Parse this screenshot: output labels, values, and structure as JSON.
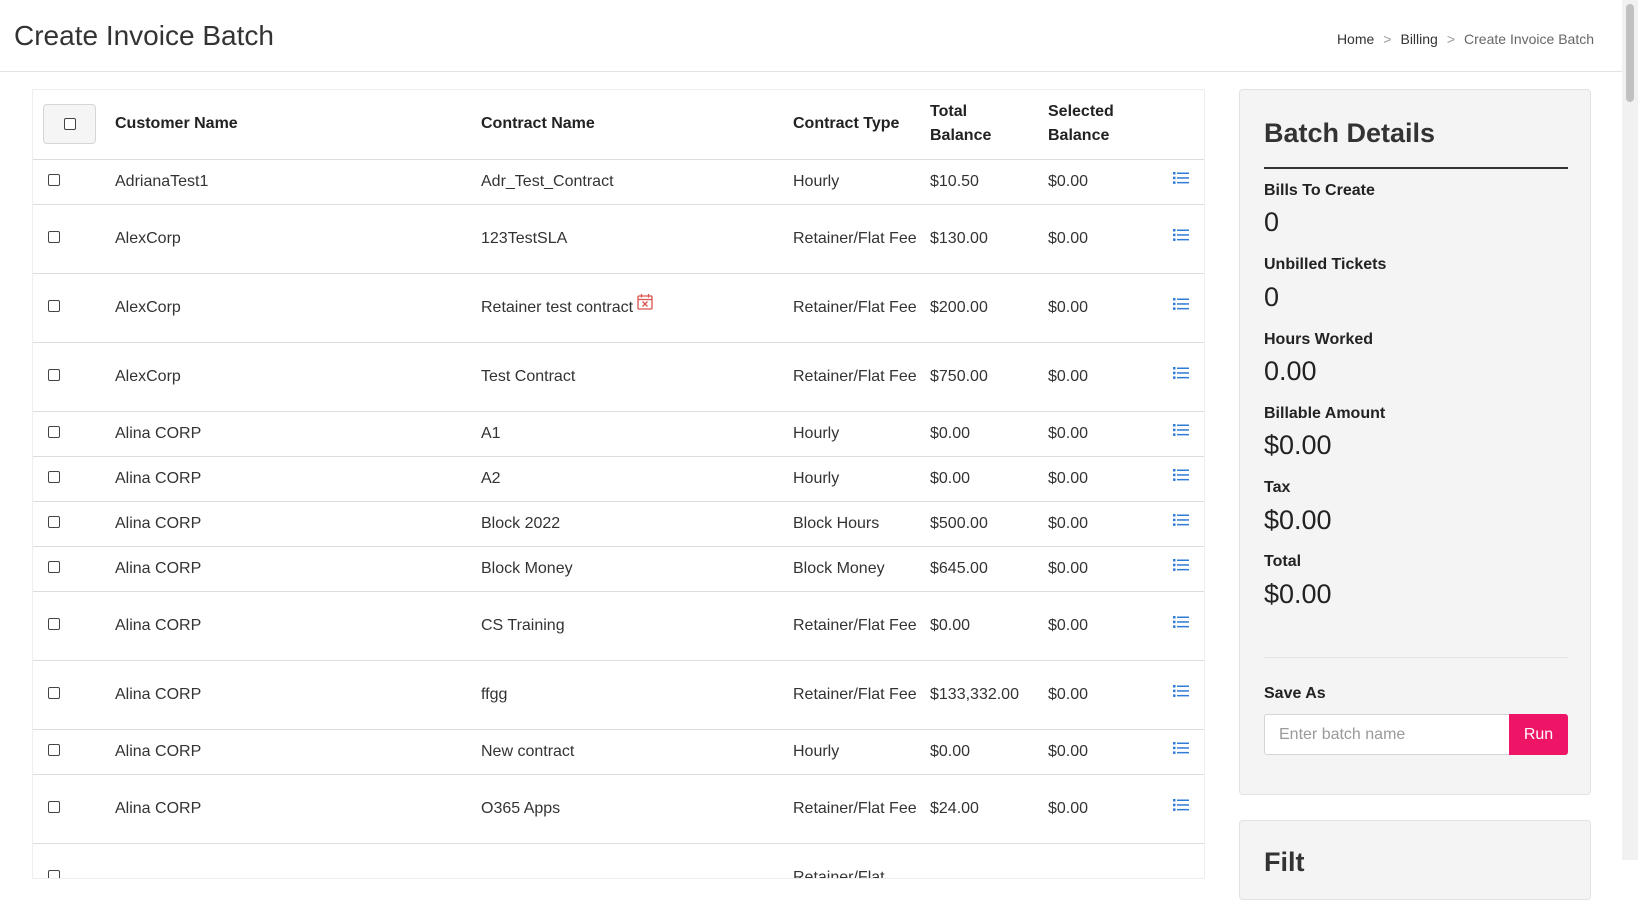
{
  "header": {
    "title": "Create Invoice Batch",
    "breadcrumb": [
      {
        "label": "Home"
      },
      {
        "label": "Billing"
      },
      {
        "label": "Create Invoice Batch"
      }
    ],
    "separator": ">"
  },
  "table": {
    "columns": {
      "customer": "Customer Name",
      "contract": "Contract Name",
      "type": "Contract Type",
      "total_line1": "Total",
      "total_line2": "Balance",
      "selected_line1": "Selected",
      "selected_line2": "Balance"
    },
    "rows": [
      {
        "customer": "AdrianaTest1",
        "contract": "Adr_Test_Contract",
        "type": "Hourly",
        "total": "$10.50",
        "selected": "$0.00"
      },
      {
        "customer": "AlexCorp",
        "contract": "123TestSLA",
        "type": "Retainer/Flat Fee",
        "total": "$130.00",
        "selected": "$0.00"
      },
      {
        "customer": "AlexCorp",
        "contract": "Retainer test contract",
        "type": "Retainer/Flat Fee",
        "total": "$200.00",
        "selected": "$0.00",
        "expired_icon": "calendar-x-icon"
      },
      {
        "customer": "AlexCorp",
        "contract": "Test Contract",
        "type": "Retainer/Flat Fee",
        "total": "$750.00",
        "selected": "$0.00"
      },
      {
        "customer": "Alina CORP",
        "contract": "A1",
        "type": "Hourly",
        "total": "$0.00",
        "selected": "$0.00"
      },
      {
        "customer": "Alina CORP",
        "contract": "A2",
        "type": "Hourly",
        "total": "$0.00",
        "selected": "$0.00"
      },
      {
        "customer": "Alina CORP",
        "contract": "Block 2022",
        "type": "Block Hours",
        "total": "$500.00",
        "selected": "$0.00"
      },
      {
        "customer": "Alina CORP",
        "contract": "Block Money",
        "type": "Block Money",
        "total": "$645.00",
        "selected": "$0.00"
      },
      {
        "customer": "Alina CORP",
        "contract": "CS Training",
        "type": "Retainer/Flat Fee",
        "total": "$0.00",
        "selected": "$0.00"
      },
      {
        "customer": "Alina CORP",
        "contract": "ffgg",
        "type": "Retainer/Flat Fee",
        "total": "$133,332.00",
        "selected": "$0.00"
      },
      {
        "customer": "Alina CORP",
        "contract": "New contract",
        "type": "Hourly",
        "total": "$0.00",
        "selected": "$0.00"
      },
      {
        "customer": "Alina CORP",
        "contract": "O365 Apps",
        "type": "Retainer/Flat Fee",
        "total": "$24.00",
        "selected": "$0.00"
      },
      {
        "customer": "",
        "contract": "",
        "type": "Retainer/Flat",
        "total": "",
        "selected": ""
      }
    ]
  },
  "batch_details": {
    "title": "Batch Details",
    "stats": [
      {
        "label": "Bills To Create",
        "value": "0"
      },
      {
        "label": "Unbilled Tickets",
        "value": "0"
      },
      {
        "label": "Hours Worked",
        "value": "0.00"
      },
      {
        "label": "Billable Amount",
        "value": "$0.00"
      },
      {
        "label": "Tax",
        "value": "$0.00"
      },
      {
        "label": "Total",
        "value": "$0.00"
      }
    ],
    "save_as_label": "Save As",
    "batch_name_value": "",
    "batch_name_placeholder": "Enter batch name",
    "run_label": "Run"
  },
  "filters_card": {
    "title": "Filt"
  },
  "colors": {
    "accent_run": "#ee1466",
    "list_icon": "#2f7bd6",
    "expired_icon": "#d9534f"
  }
}
